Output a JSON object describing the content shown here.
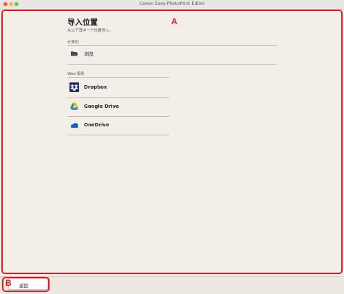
{
  "window": {
    "title": "Canon Easy-PhotoPrint Editor"
  },
  "page": {
    "title": "导入位置",
    "subtitle": "从以下其中一个位置导入。"
  },
  "sections": {
    "computer": {
      "label": "计算机",
      "items": [
        {
          "label": "浏览",
          "icon": "folder-icon"
        }
      ]
    },
    "web": {
      "label": "Web 服务",
      "items": [
        {
          "label": "Dropbox",
          "icon": "dropbox-icon"
        },
        {
          "label": "Google Drive",
          "icon": "google-drive-icon"
        },
        {
          "label": "OneDrive",
          "icon": "onedrive-icon"
        }
      ]
    }
  },
  "footer": {
    "back_label": "返回"
  },
  "annotations": {
    "a": "A",
    "b": "B"
  },
  "colors": {
    "annotation": "#e8141d",
    "background": "#f3efe8"
  }
}
